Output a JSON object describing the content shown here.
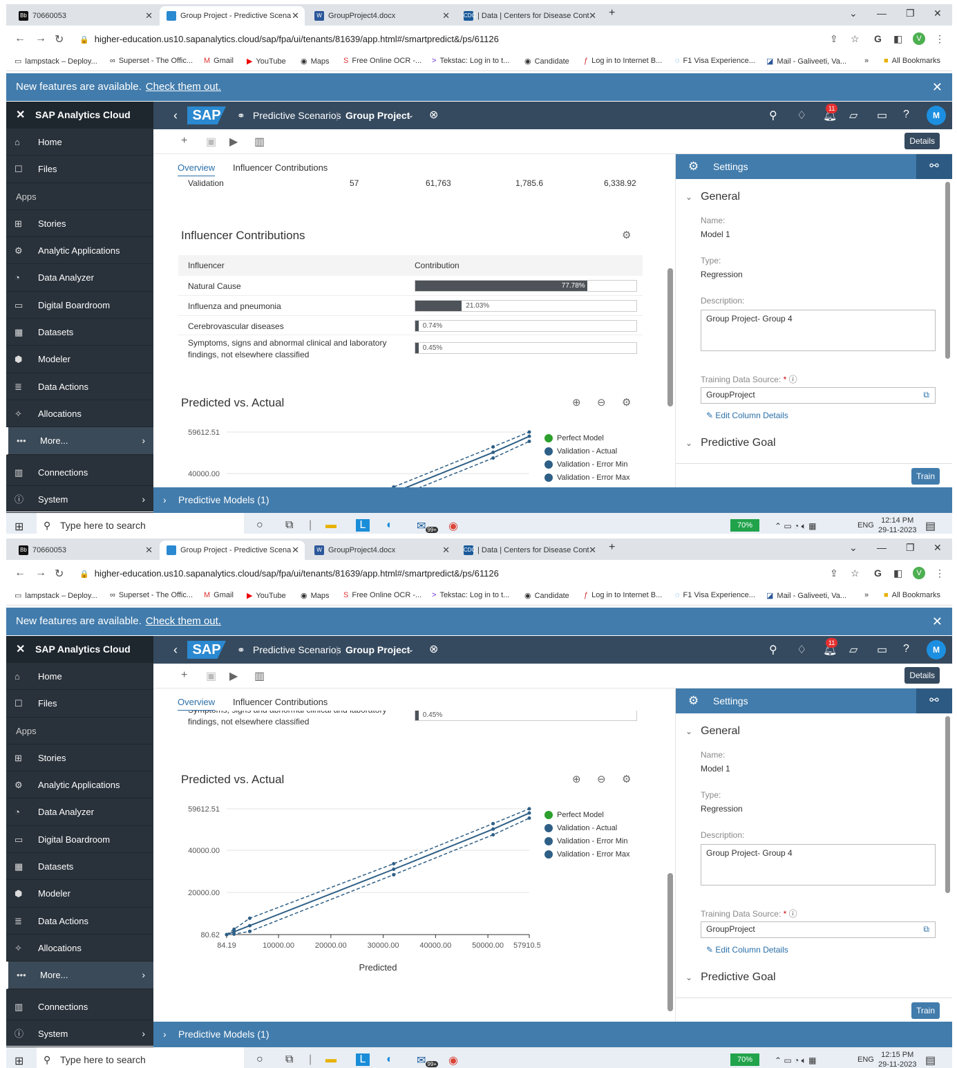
{
  "browser": {
    "tabs": [
      {
        "title": "70660053",
        "icon": "Bb"
      },
      {
        "title": "Group Project - Predictive Scena",
        "icon": "sap-icon"
      },
      {
        "title": "GroupProject4.docx",
        "icon": "W"
      },
      {
        "title": "| Data | Centers for Disease Cont",
        "icon": "CDC"
      }
    ],
    "url": "higher-education.us10.sapanalytics.cloud/sap/fpa/ui/tenants/81639/app.html#/smartpredict&/ps/61126",
    "bookmarks": [
      "lampstack – Deploy...",
      "Superset - The Offic...",
      "Gmail",
      "YouTube",
      "Maps",
      "Free Online OCR -...",
      "Tekstac: Log in to t...",
      "Candidate",
      "Log in to Internet B...",
      "F1 Visa Experience...",
      "Mail - Galiveeti, Va...",
      "»",
      "All Bookmarks"
    ],
    "avatar_letter": "V"
  },
  "notice": {
    "text": "New features are available.",
    "link": "Check them out."
  },
  "shell": {
    "brand": "SAP",
    "app": "Predictive Scenarios",
    "project": "Group Project",
    "notifications": "11",
    "user": "M"
  },
  "sidebar": {
    "title": "SAP Analytics Cloud",
    "items": [
      "Home",
      "Files",
      "Apps",
      "Stories",
      "Analytic Applications",
      "Data Analyzer",
      "Digital Boardroom",
      "Datasets",
      "Modeler",
      "Data Actions",
      "Allocations",
      "More...",
      "Connections",
      "System"
    ]
  },
  "toolbar": {
    "details": "Details"
  },
  "view_tabs": [
    "Overview",
    "Influencer Contributions"
  ],
  "validation_row": {
    "label": "Validation",
    "values": [
      "57",
      "61,763",
      "1,785.6",
      "6,338.92"
    ]
  },
  "influencers": {
    "title": "Influencer Contributions",
    "headers": [
      "Influencer",
      "Contribution"
    ],
    "rows": [
      {
        "name": "Natural Cause",
        "pct": 77.78,
        "label": "77.78%"
      },
      {
        "name": "Influenza and pneumonia",
        "pct": 21.03,
        "label": "21.03%"
      },
      {
        "name": "Cerebrovascular diseases",
        "pct": 0.74,
        "label": "0.74%"
      },
      {
        "name": "Symptoms, signs and abnormal clinical and laboratory findings, not elsewhere classified",
        "pct": 0.45,
        "label": "0.45%"
      }
    ],
    "row4_line1": "Symptoms, signs and abnormal clinical and laboratory",
    "row4_line2": "findings, not elsewhere classified"
  },
  "chart_data": {
    "type": "line",
    "title": "Predicted vs. Actual",
    "xlabel": "Predicted",
    "ylabel": "",
    "x_ticks": [
      "84.19",
      "10000.00",
      "20000.00",
      "30000.00",
      "40000.00",
      "50000.00",
      "57910.50"
    ],
    "y_ticks": [
      "80.62",
      "20000.00",
      "40000.00",
      "59612.51"
    ],
    "xlim": [
      84.19,
      57910.5
    ],
    "ylim": [
      80.62,
      59612.51
    ],
    "legend": [
      {
        "name": "Perfect Model",
        "color": "#2ca02c"
      },
      {
        "name": "Validation - Actual",
        "color": "#2e5f86"
      },
      {
        "name": "Validation - Error Min",
        "color": "#2e5f86"
      },
      {
        "name": "Validation - Error Max",
        "color": "#2e5f86"
      }
    ],
    "series": [
      {
        "name": "Validation - Actual",
        "x": [
          84.19,
          1500,
          4500,
          32000,
          51000,
          57910.5
        ],
        "y": [
          80.62,
          1400,
          4300,
          31000,
          50000,
          57600
        ]
      },
      {
        "name": "Validation - Error Min",
        "x": [
          84.19,
          1500,
          4500,
          32000,
          51000,
          57910.5
        ],
        "y": [
          80.62,
          300,
          1600,
          28400,
          47300,
          55200
        ]
      },
      {
        "name": "Validation - Error Max",
        "x": [
          84.19,
          1500,
          4500,
          32000,
          51000,
          57910.5
        ],
        "y": [
          80.62,
          2600,
          7800,
          33600,
          52600,
          59612.51
        ]
      }
    ]
  },
  "settings": {
    "title": "Settings",
    "general": "General",
    "name_label": "Name:",
    "name": "Model 1",
    "type_label": "Type:",
    "type": "Regression",
    "desc_label": "Description:",
    "desc": "Group Project- Group 4",
    "source_label": "Training Data Source:",
    "required": "*",
    "source": "GroupProject",
    "edit_cols": "Edit Column Details",
    "goal": "Predictive Goal",
    "train": "Train"
  },
  "predictive_models": "Predictive Models (1)",
  "taskbar": {
    "search": "Type here to search",
    "battery": "70%",
    "lang": "ENG",
    "date": "29-11-2023",
    "time1": "12:14 PM",
    "time2": "12:15 PM",
    "mail_count": "99+"
  }
}
